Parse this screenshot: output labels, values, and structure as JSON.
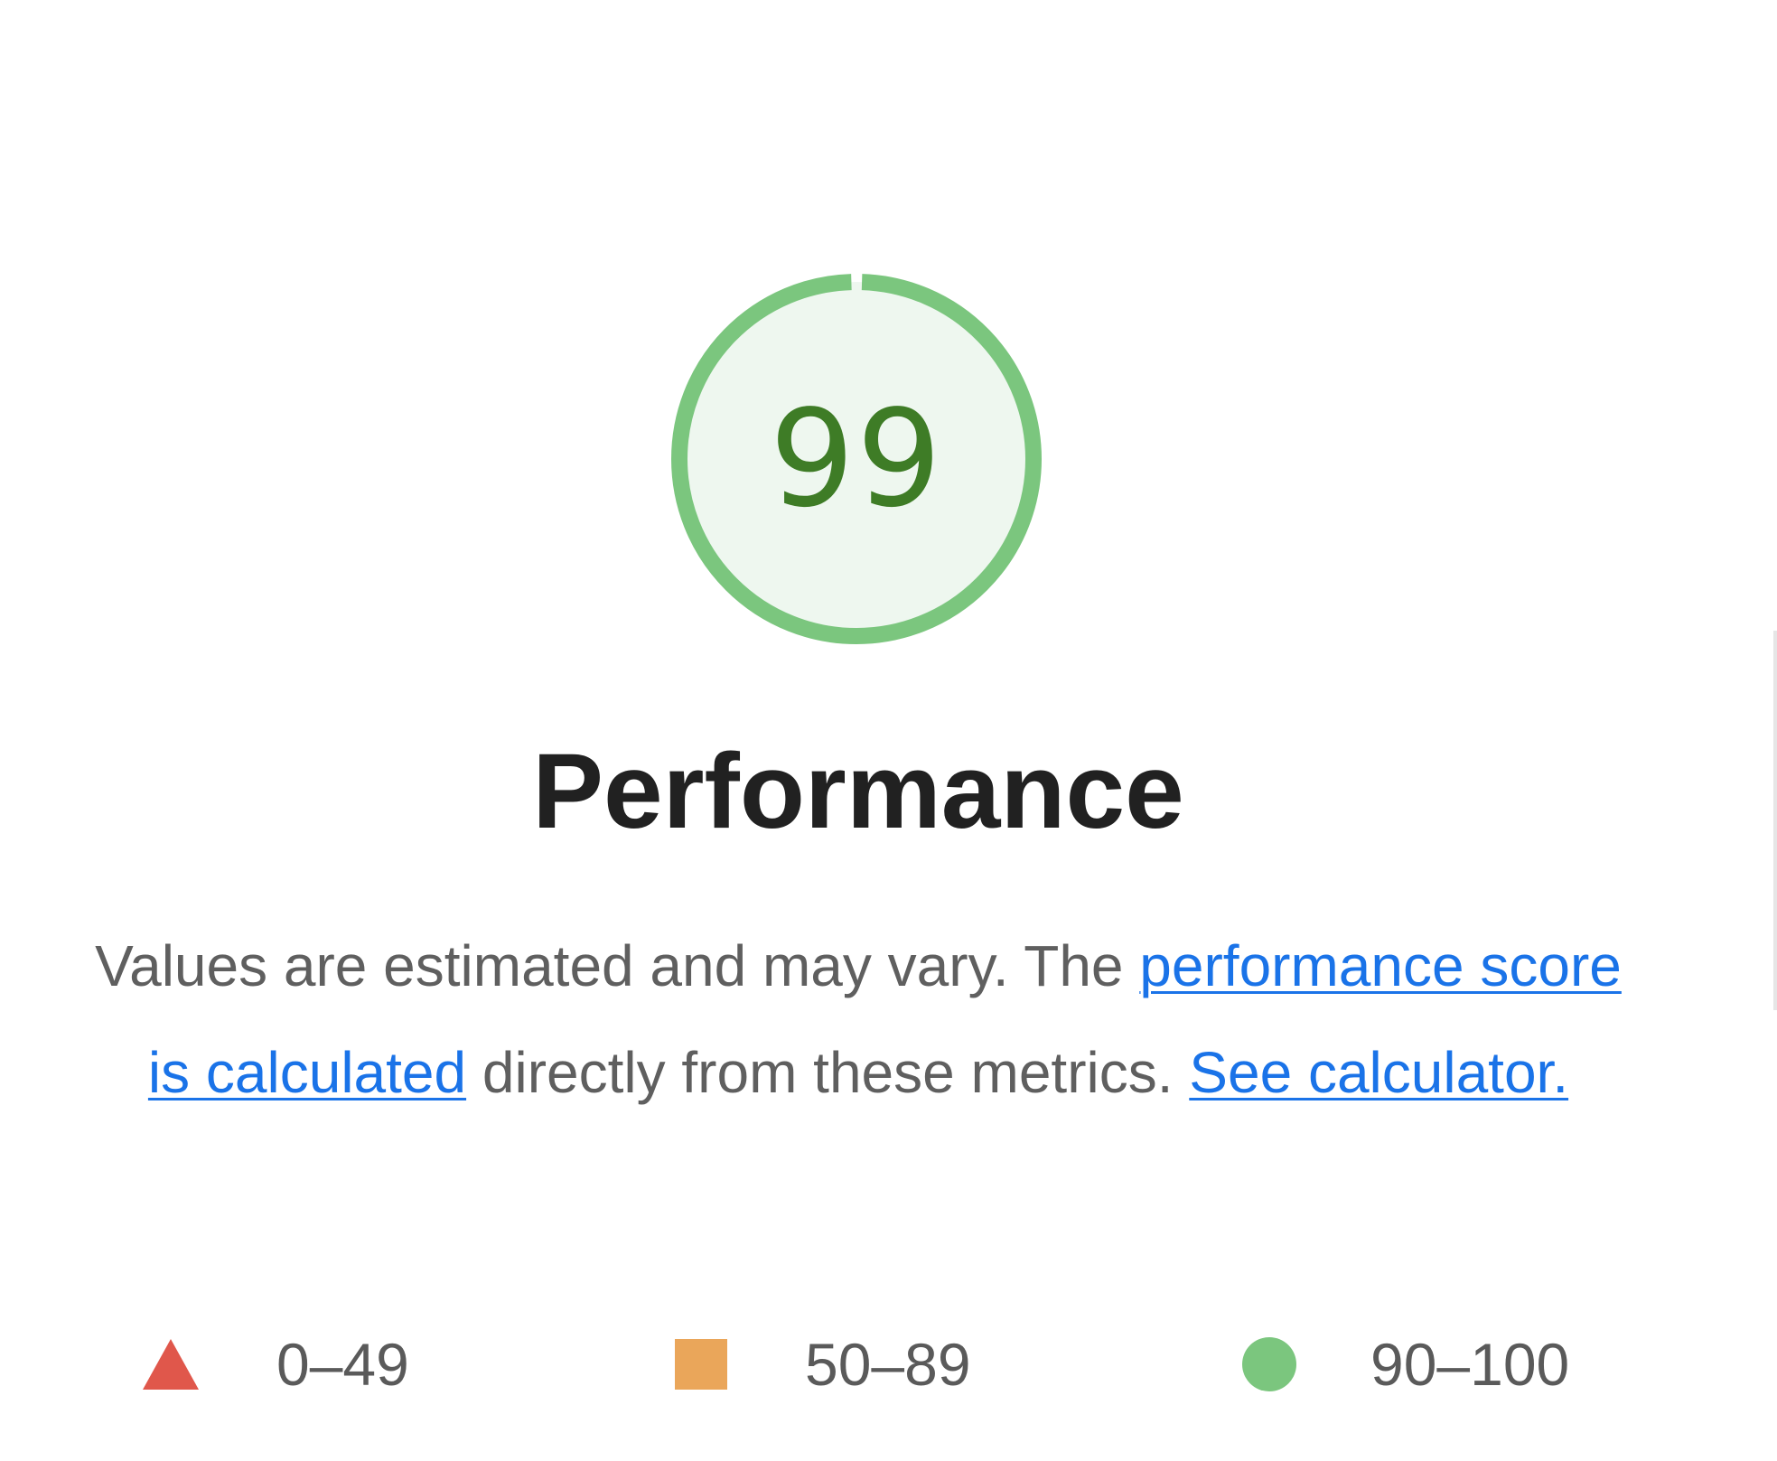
{
  "gauge": {
    "score": "99",
    "score_fraction": 0.99,
    "ring_color": "#7bc67e",
    "fill_color": "#eef7ef",
    "text_color": "#3e7c26"
  },
  "category": {
    "title": "Performance"
  },
  "description": {
    "text_before": "Values are estimated and may vary. The ",
    "link_score": "performance score is calculated",
    "text_middle": " directly from these metrics. ",
    "link_calculator": "See calculator."
  },
  "legend": [
    {
      "label": "0–49",
      "shape": "triangle",
      "color": "#e0574b"
    },
    {
      "label": "50–89",
      "shape": "square",
      "color": "#eaa65a"
    },
    {
      "label": "90–100",
      "shape": "circle",
      "color": "#7bc67e"
    }
  ],
  "colors": {
    "link": "#1a73e8",
    "title": "#212121",
    "body_text": "#5f5f5f"
  }
}
